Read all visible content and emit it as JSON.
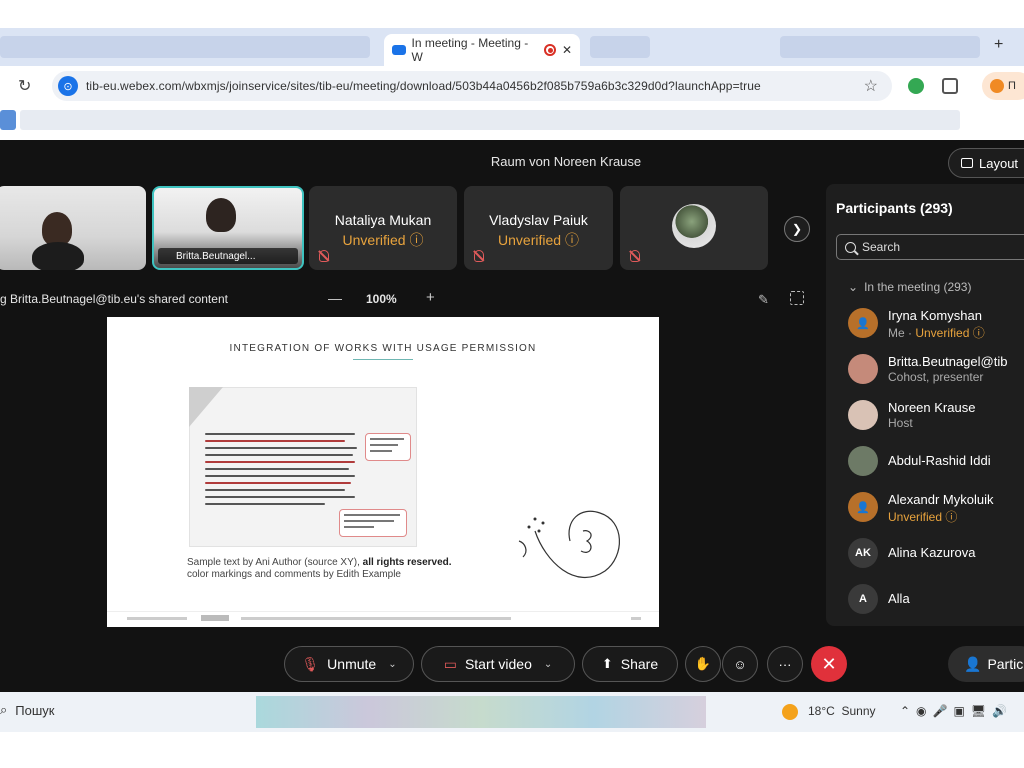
{
  "browser": {
    "active_tab": {
      "title": "In meeting - Meeting - W"
    },
    "url": "tib-eu.webex.com/wbxmjs/joinservice/sites/tib-eu/meeting/download/503b44a0456b2f085b759a6b3c329d0d?launchApp=true",
    "profile_label": "П"
  },
  "meeting": {
    "room_title": "Raum von Noreen Krause",
    "layout_label": "Layout",
    "tiles": [
      {
        "name": "Nataliya Mukan",
        "status": "Unverified"
      },
      {
        "name": "Vladyslav Paiuk",
        "status": "Unverified"
      },
      {
        "name": "Britta.Beutnagel..."
      }
    ],
    "shared_content_label": "g Britta.Beutnagel@tib.eu's shared content",
    "zoom": "100%"
  },
  "slide": {
    "title": "INTEGRATION OF WORKS WITH USAGE PERMISSION",
    "caption_prefix": "Sample text by Ani Author (source XY), ",
    "caption_bold": "all rights reserved.",
    "caption_line2": "color markings and comments by Edith Example"
  },
  "participants": {
    "title": "Participants (293)",
    "search_placeholder": "Search",
    "group_label": "In the meeting (293)",
    "list": [
      {
        "name": "Iryna Komyshan",
        "sub": "Me",
        "status": "Unverified",
        "initials": ""
      },
      {
        "name": "Britta.Beutnagel@tib",
        "sub": "Cohost, presenter",
        "initials": ""
      },
      {
        "name": "Noreen Krause",
        "sub": "Host",
        "initials": ""
      },
      {
        "name": "Abdul-Rashid Iddi",
        "sub": "",
        "initials": ""
      },
      {
        "name": "Alexandr Mykoluik",
        "status": "Unverified",
        "initials": ""
      },
      {
        "name": "Alina Kazurova",
        "initials": "AK"
      },
      {
        "name": "Alla",
        "initials": "A"
      }
    ]
  },
  "controls": {
    "unmute": "Unmute",
    "start_video": "Start video",
    "share": "Share",
    "participants": "Partic"
  },
  "taskbar": {
    "search": "Пошук",
    "weather_temp": "18°C",
    "weather_desc": "Sunny"
  },
  "colors": {
    "accent_unverified": "#e8a33d",
    "active_speaker_border": "#3ec3c0",
    "end_call": "#e0313b"
  }
}
